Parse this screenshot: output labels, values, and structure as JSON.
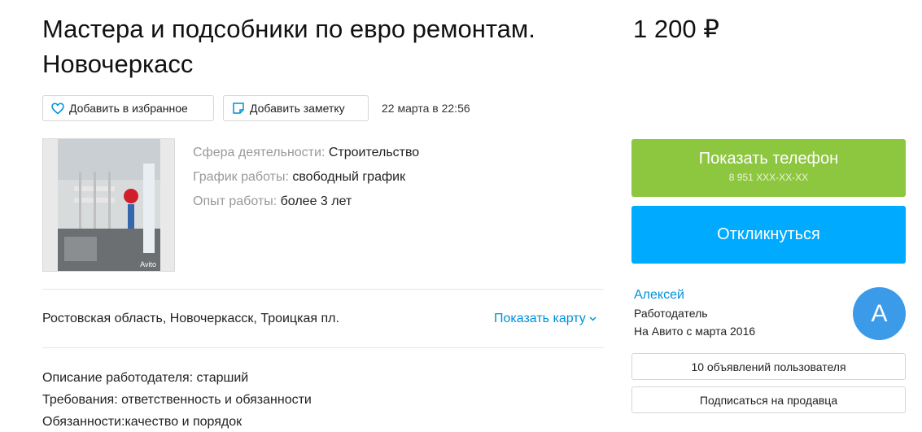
{
  "listing": {
    "title": "Мастера и подсобники по евро ремонтам. Новочеркасс",
    "price": "1 200 ₽",
    "date": "22 марта в 22:56"
  },
  "actions": {
    "favorite_label": "Добавить в избранное",
    "note_label": "Добавить заметку"
  },
  "photo": {
    "watermark": "Avito"
  },
  "attributes": [
    {
      "key": "Сфера деятельности:",
      "value": "Строительство"
    },
    {
      "key": "График работы:",
      "value": "свободный график"
    },
    {
      "key": "Опыт работы:",
      "value": "более 3 лет"
    }
  ],
  "location": {
    "address": "Ростовская область, Новочеркасск, Троицкая пл.",
    "map_link": "Показать карту"
  },
  "description": [
    "Описание работодателя: старший",
    "Требования: ответственность и обязанности",
    "Обязанности:качество и порядок"
  ],
  "contact": {
    "phone_button": "Показать телефон",
    "phone_masked": "8 951 XXX-XX-XX",
    "respond_button": "Откликнуться"
  },
  "seller": {
    "name": "Алексей",
    "role": "Работодатель",
    "since": "На Авито с марта 2016",
    "avatar_letter": "А",
    "ads_button": "10 объявлений пользователя",
    "subscribe_button": "Подписаться на продавца"
  },
  "colors": {
    "phone_button": "#8dc63f",
    "respond_button": "#00aaff",
    "link": "#0091d9",
    "avatar": "#3b9be8"
  }
}
